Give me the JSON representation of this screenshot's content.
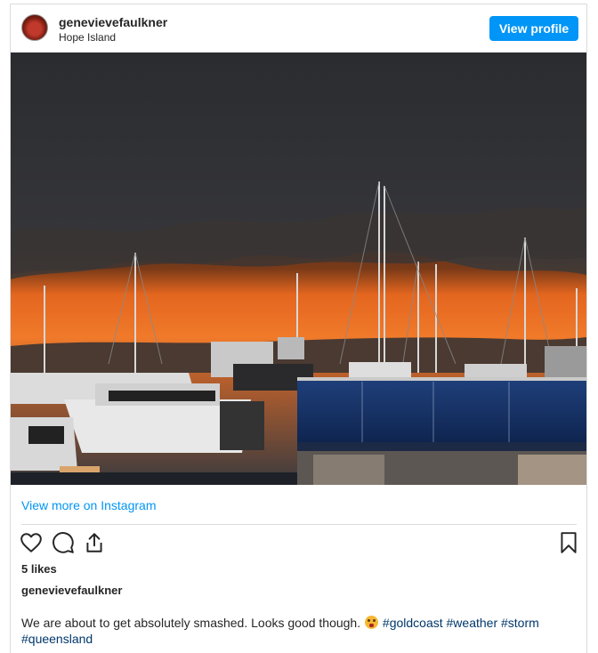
{
  "post": {
    "username": "genevievefaulkner",
    "location": "Hope Island",
    "view_profile_label": "View profile",
    "view_more_label": "View more on Instagram",
    "likes": "5 likes",
    "caption_user": "genevievefaulkner",
    "caption_text": "We are about to get absolutely smashed. Looks good though.",
    "hashtags": [
      "#goldcoast",
      "#weather",
      "#storm",
      "#queensland"
    ]
  },
  "colors": {
    "accent": "#0095f6",
    "hashtag": "#00376b",
    "text": "#262626",
    "border": "#dbdbdb"
  },
  "icons": [
    "heart-icon",
    "comment-icon",
    "share-icon",
    "bookmark-icon"
  ]
}
